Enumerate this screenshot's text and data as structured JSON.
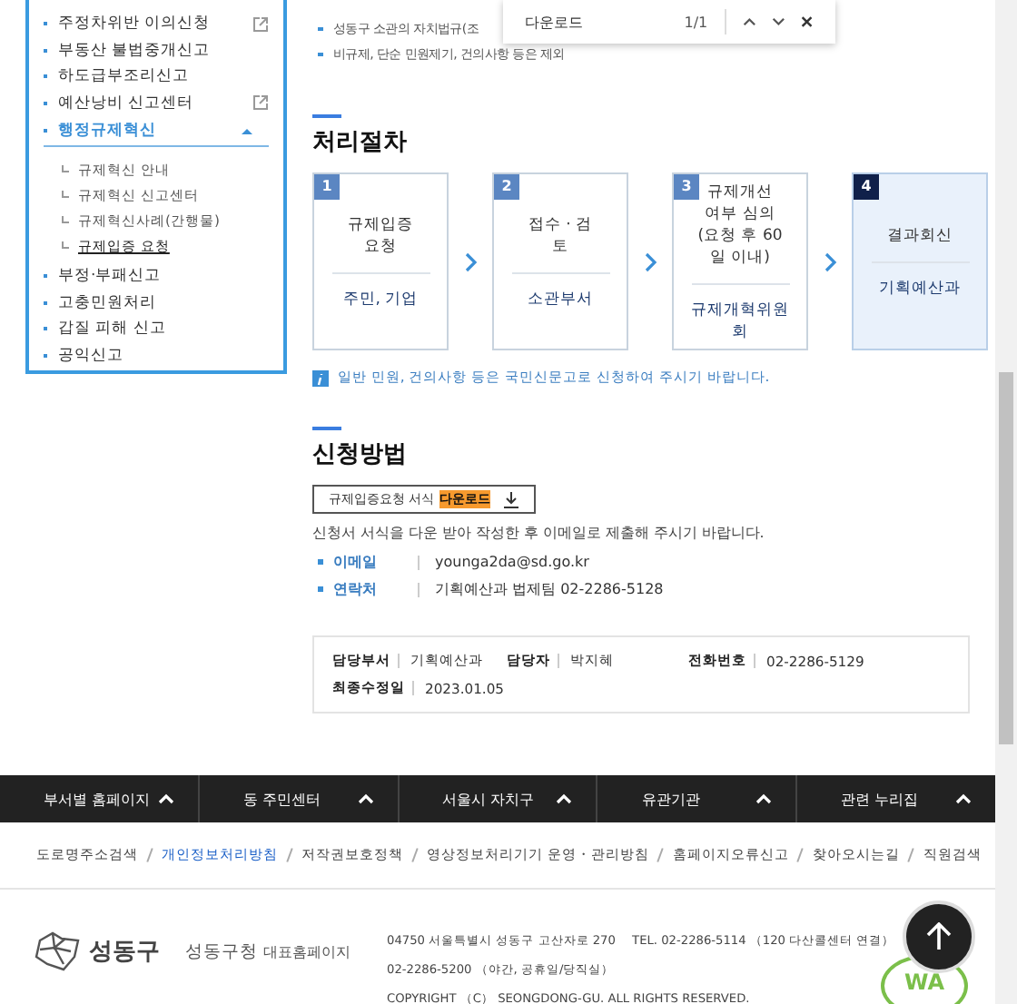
{
  "sidebar": {
    "items": [
      {
        "label": "주정차위반 이의신청",
        "external": true,
        "expanded": false
      },
      {
        "label": "부동산 불법중개신고",
        "external": false,
        "expanded": false
      },
      {
        "label": "하도급부조리신고",
        "external": false,
        "expanded": false
      },
      {
        "label": "예산낭비 신고센터",
        "external": true,
        "expanded": false
      },
      {
        "label": "행정규제혁신",
        "external": false,
        "expanded": true,
        "children": [
          {
            "label": "규제혁신 안내",
            "selected": false
          },
          {
            "label": "규제혁신 신고센터",
            "selected": false
          },
          {
            "label": "규제혁신사례(간행물)",
            "selected": false
          },
          {
            "label": "규제입증 요청",
            "selected": true
          }
        ]
      },
      {
        "label": "부정·부패신고",
        "external": false,
        "expanded": false
      },
      {
        "label": "고충민원처리",
        "external": false,
        "expanded": false
      },
      {
        "label": "갑질 피해 신고",
        "external": false,
        "expanded": false
      },
      {
        "label": "공익신고",
        "external": false,
        "expanded": false
      }
    ]
  },
  "find_bar": {
    "query": "다운로드",
    "count": "1/1"
  },
  "intro_bullets": [
    "성동구 소관의 자치법규(조",
    "비규제, 단순 민원제기, 건의사항 등은 제외"
  ],
  "process": {
    "title": "처리절차",
    "steps": [
      {
        "number": "1",
        "title": "규제입증\n요청",
        "owner": "주민, 기업",
        "current": false
      },
      {
        "number": "2",
        "title": "접수 · 검\n토",
        "owner": "소관부서",
        "current": false
      },
      {
        "number": "3",
        "title": "규제개선\n여부 심의\n(요청 후 60\n일 이내)",
        "owner": "규제개혁위원\n회",
        "current": false
      },
      {
        "number": "4",
        "title": "결과회신",
        "owner": "기획예산과",
        "current": true
      }
    ],
    "note": "일반 민원, 건의사항 등은 국민신문고로 신청하여 주시기 바랍니다."
  },
  "apply": {
    "title": "신청방법",
    "download_label": "규제입증요청 서식",
    "download_highlight": "다운로드",
    "description": "신청서 서식을 다운 받아 작성한 후 이메일로 제출해 주시기 바랍니다.",
    "contacts": [
      {
        "label": "이메일",
        "value": "younga2da@sd.go.kr"
      },
      {
        "label": "연락처",
        "value": "기획예산과 법제팀 02-2286-5128"
      }
    ]
  },
  "info": [
    {
      "label": "담당부서",
      "value": "기획예산과"
    },
    {
      "label": "담당자",
      "value": "박지혜"
    },
    {
      "label": "전화번호",
      "value": "02-2286-5129"
    },
    {
      "label": "최종수정일",
      "value": "2023.01.05"
    }
  ],
  "footer_nav": [
    "부서별 홈페이지",
    "동 주민센터",
    "서울시 자치구",
    "유관기관",
    "관련 누리집"
  ],
  "footer_links": [
    {
      "label": "도로명주소검색",
      "highlighted": false
    },
    {
      "label": "개인정보처리방침",
      "highlighted": true
    },
    {
      "label": "저작권보호정책",
      "highlighted": false
    },
    {
      "label": "영상정보처리기기 운영・관리방침",
      "highlighted": false
    },
    {
      "label": "홈페이지오류신고",
      "highlighted": false
    },
    {
      "label": "찾아오시는길",
      "highlighted": false
    },
    {
      "label": "직원검색",
      "highlighted": false
    }
  ],
  "footer": {
    "logo_text": "성동구",
    "site_name": "성동구청",
    "site_suffix": "대표홈페이지",
    "address_lines": [
      "04750 서울특별시 성동구 고산자로 270 　TEL. 02-2286-5114 （120 다산콜센터 연결）",
      "02-2286-5200 （야간, 공휴일/당직실）",
      "COPYRIGHT （C） SEONGDONG-GU. ALL RIGHTS RESERVED."
    ],
    "badge": "WA"
  }
}
